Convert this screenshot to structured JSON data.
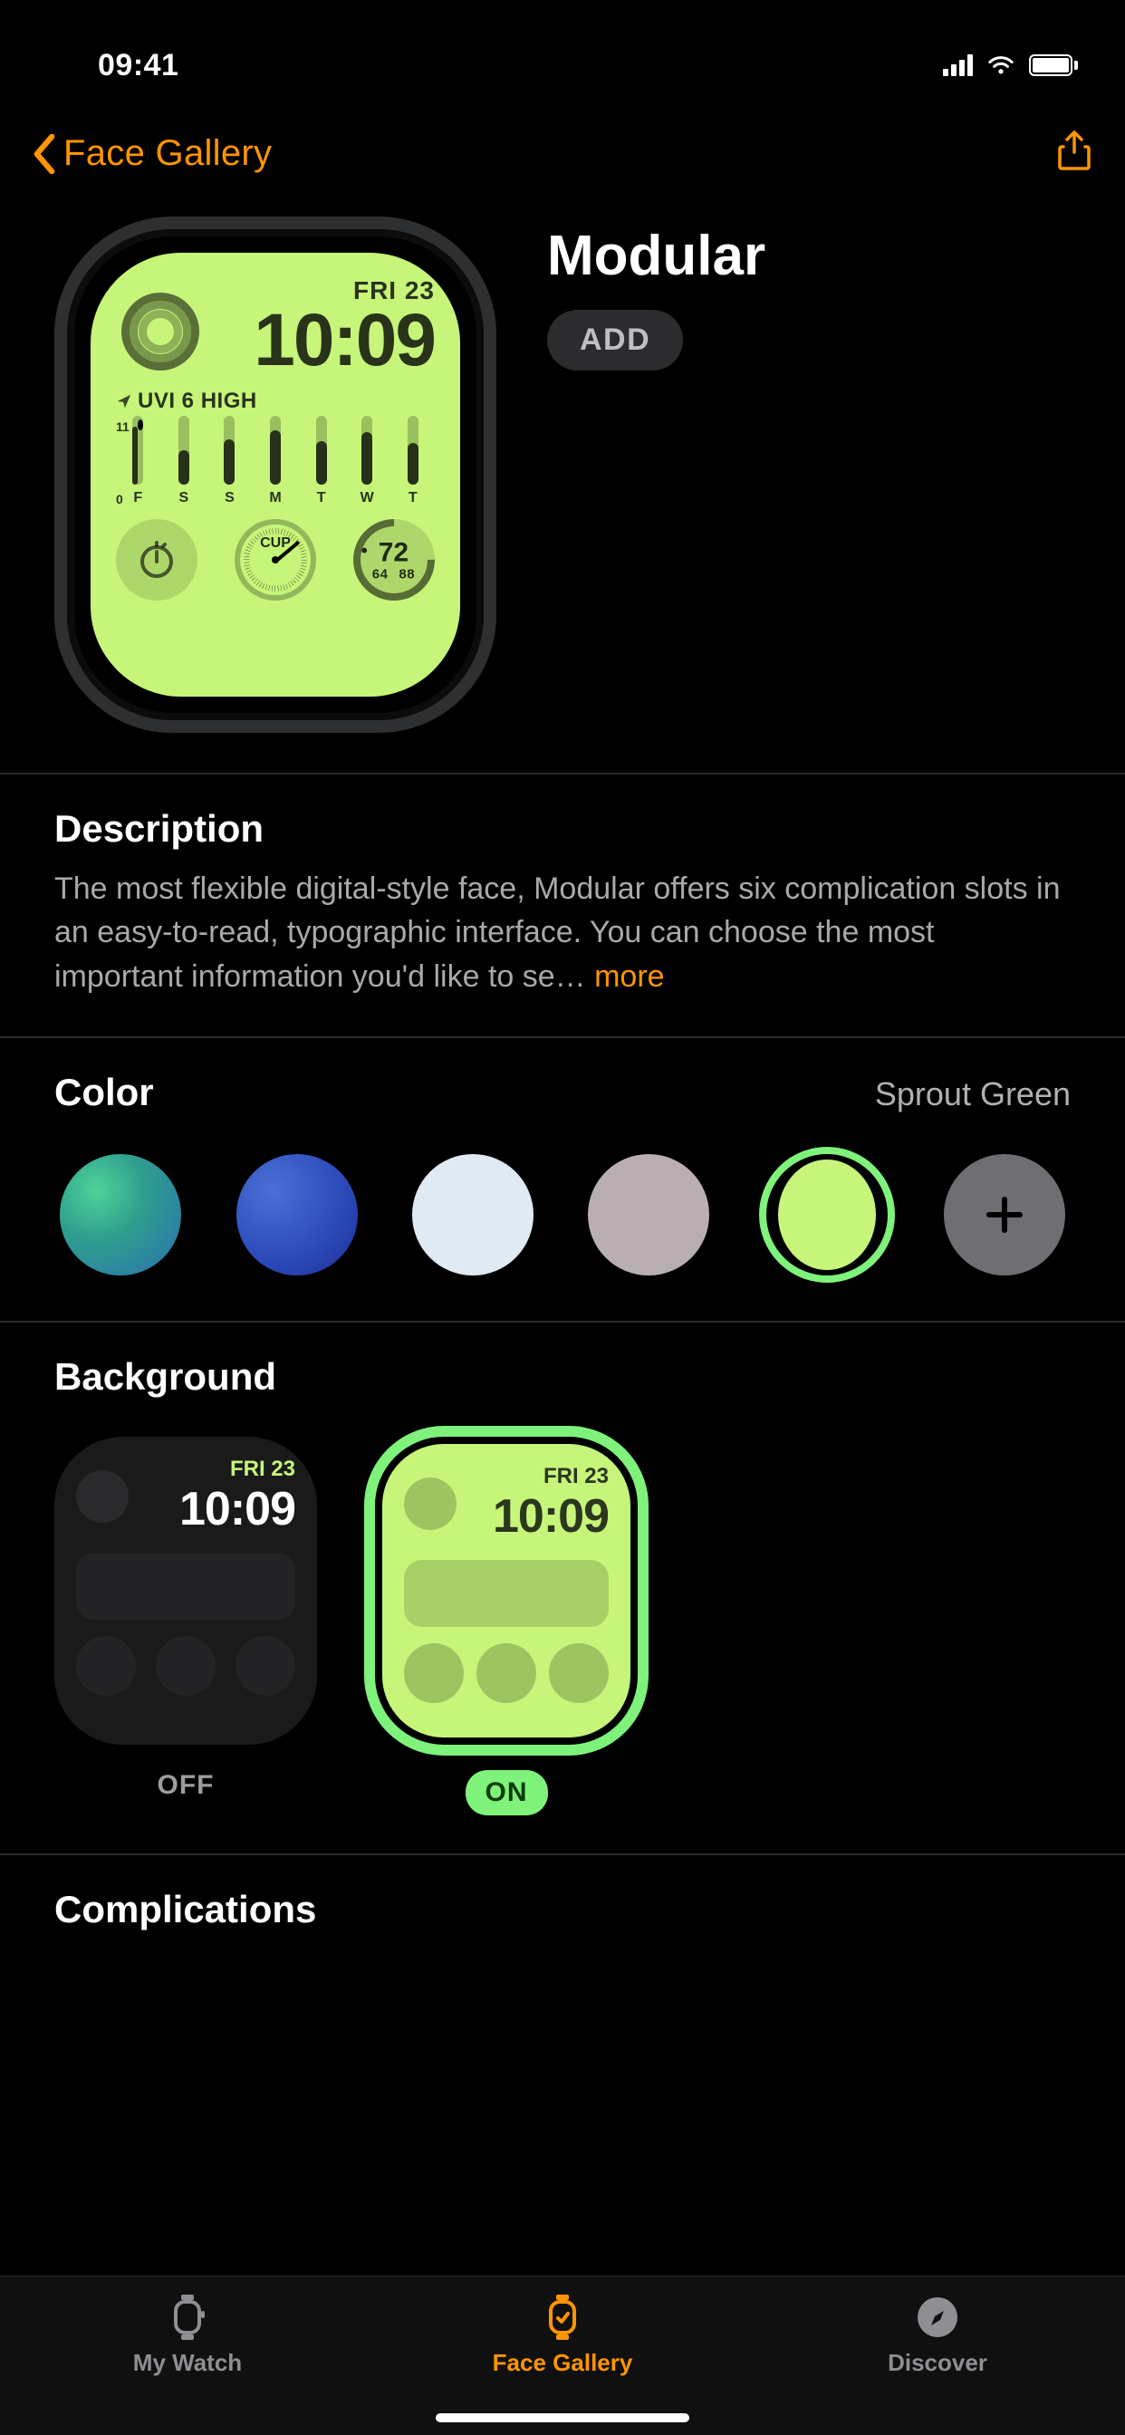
{
  "status": {
    "time": "09:41"
  },
  "nav": {
    "back_label": "Face Gallery"
  },
  "hero": {
    "title": "Modular",
    "add_label": "ADD"
  },
  "watchface": {
    "date": "FRI 23",
    "time": "10:09",
    "uvi_label": "UVI 6 HIGH",
    "week_axis_high": "11",
    "week_axis_low": "0",
    "week_days": [
      "F",
      "S",
      "S",
      "M",
      "T",
      "W",
      "T"
    ],
    "cup_label": "CUP",
    "temp_value": "72",
    "temp_low": "64",
    "temp_high": "88"
  },
  "description": {
    "heading": "Description",
    "body": "The most flexible digital-style face, Modular offers six complication slots in an easy-to-read, typographic interface. You can choose the most important information you'd like to se…",
    "more_label": "more"
  },
  "color": {
    "heading": "Color",
    "selected_name": "Sprout Green",
    "swatches": [
      {
        "name": "teal-gradient",
        "css": "radial-gradient(circle at 30% 30%, #4fd39a 0%, #2f9f8d 40%, #2b6fb0 100%)"
      },
      {
        "name": "royal-blue",
        "css": "radial-gradient(circle at 30% 30%, #4a6fd6 0%, #2b49b8 60%, #1f2e94 100%)"
      },
      {
        "name": "glacier",
        "css": "#dfeaf2"
      },
      {
        "name": "warm-gray",
        "css": "#b9afb3"
      },
      {
        "name": "sprout-green",
        "css": "#c6f57a",
        "selected": true
      },
      {
        "name": "add",
        "plus": true
      }
    ]
  },
  "background": {
    "heading": "Background",
    "date": "FRI 23",
    "time": "10:09",
    "off_label": "OFF",
    "on_label": "ON"
  },
  "complications": {
    "heading": "Complications"
  },
  "tabs": {
    "my_watch": "My Watch",
    "face_gallery": "Face Gallery",
    "discover": "Discover"
  }
}
